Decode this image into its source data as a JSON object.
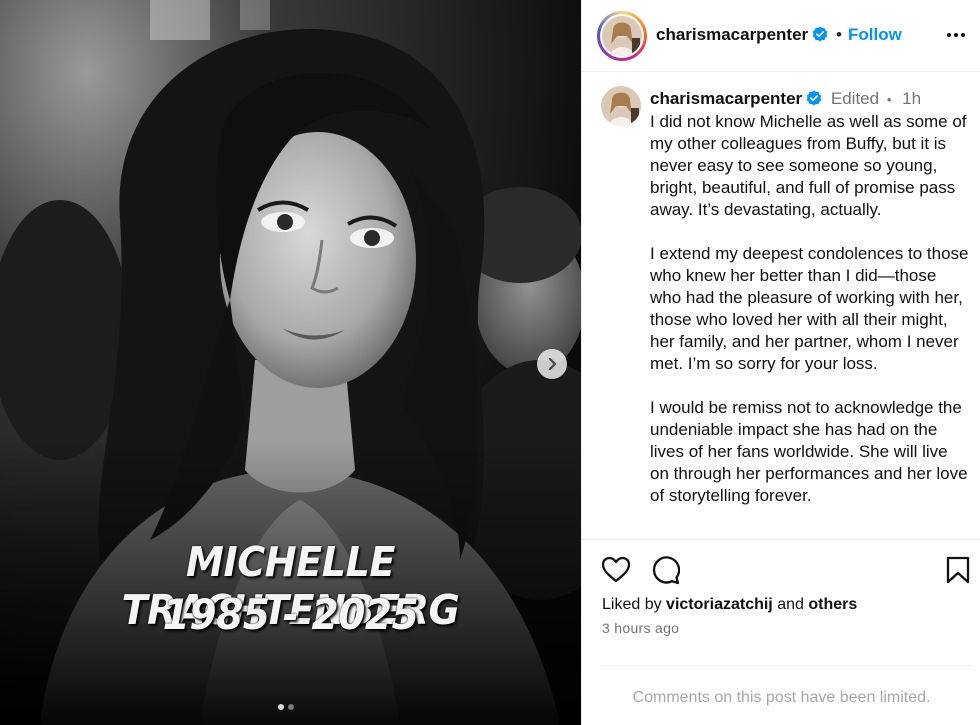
{
  "post": {
    "image_alt": "Black and white portrait of a smiling woman with long dark hair",
    "caption_name": "MICHELLE TRACHTENBERG",
    "caption_years": "1985 - 2025",
    "carousel_dots": 2,
    "active_dot": 0
  },
  "header": {
    "username": "charismacarpenter",
    "separator": "•",
    "follow_label": "Follow"
  },
  "comment": {
    "username": "charismacarpenter",
    "edited_label": "Edited",
    "separator": "•",
    "age": "1h",
    "text": "I did not know Michelle as well as some of my other colleagues from Buffy, but it is never easy to see someone so young, bright, beautiful, and full of promise pass away. It’s devastating, actually.\n\nI extend my deepest condolences to those who knew her better than I did—those who had the pleasure of working with her, those who loved her with all their might, her family, and her partner, whom I never met. I’m so sorry for your loss.\n\nI would be remiss not to acknowledge the undeniable impact she has had on the lives of her fans worldwide. She will live on through her performances and her love of storytelling forever."
  },
  "engagement": {
    "liked_prefix": "Liked by",
    "liked_user": "victoriazatchij",
    "liked_and": "and",
    "liked_others": "others",
    "timestamp": "3 hours ago",
    "comments_limited": "Comments on this post have been limited."
  },
  "colors": {
    "accent": "#0095f6",
    "verified": "#0095f6",
    "muted": "#737373"
  }
}
